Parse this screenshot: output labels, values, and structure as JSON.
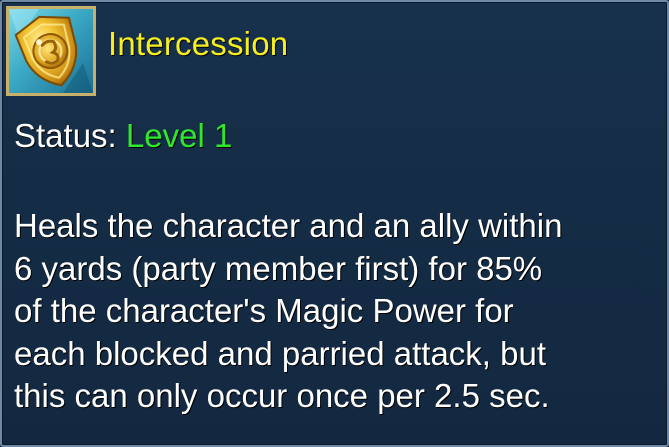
{
  "skill": {
    "icon": "golden-shield-icon",
    "name": "Intercession",
    "status_label": "Status:",
    "status_value": "Level 1",
    "description_lines": [
      "Heals the character and an ally within",
      "6 yards (party member first) for 85%",
      "of the character's Magic Power for",
      "each blocked and parried attack, but",
      "this can only occur once per 2.5 sec."
    ]
  },
  "colors": {
    "background": "#152c46",
    "border": "#6e88a6",
    "title": "#f6ef1f",
    "status_value": "#2fe82b",
    "text": "#ffffff"
  }
}
